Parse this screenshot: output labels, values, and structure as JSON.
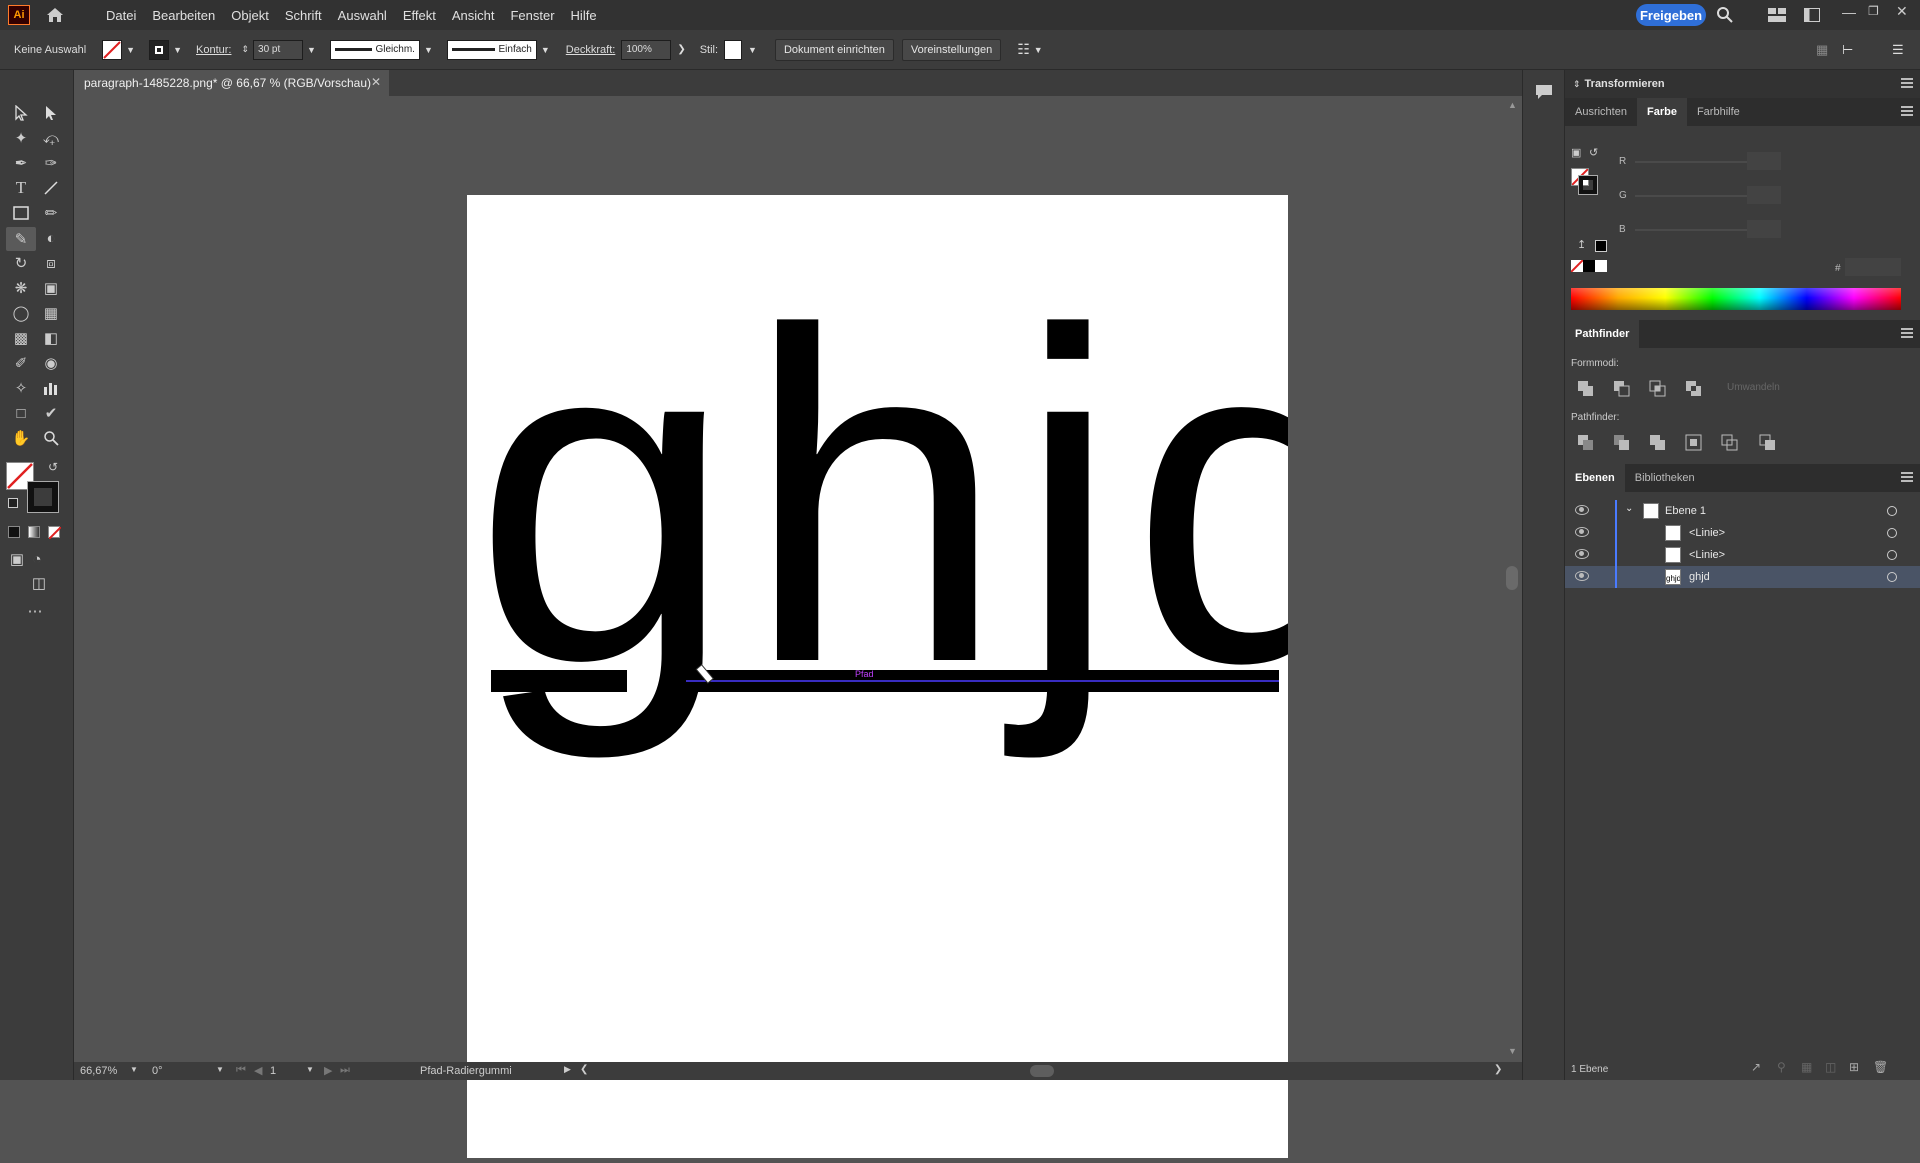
{
  "app": {
    "logo": "Ai"
  },
  "menu": [
    "Datei",
    "Bearbeiten",
    "Objekt",
    "Schrift",
    "Auswahl",
    "Effekt",
    "Ansicht",
    "Fenster",
    "Hilfe"
  ],
  "share_label": "Freigeben",
  "control": {
    "selection": "Keine Auswahl",
    "stroke_label": "Kontur:",
    "stroke_weight": "30 pt",
    "profile": "Gleichm.",
    "brush": "Einfach",
    "opacity_label": "Deckkraft:",
    "opacity": "100%",
    "style_label": "Stil:",
    "doc_setup": "Dokument einrichten",
    "prefs": "Voreinstellungen"
  },
  "document_tab": "paragraph-1485228.png* @ 66,67 % (RGB/Vorschau)",
  "canvas": {
    "text": "ghjd",
    "path_label": "Pfad"
  },
  "status": {
    "zoom": "66,67%",
    "rotation": "0°",
    "artboard": "1",
    "tool": "Pfad-Radiergummi"
  },
  "panels": {
    "transform": "Transformieren",
    "color_tabs": [
      "Ausrichten",
      "Farbe",
      "Farbhilfe"
    ],
    "channels": [
      "R",
      "G",
      "B"
    ],
    "hex_symbol": "#",
    "pathfinder_title": "Pathfinder",
    "formmodi_label": "Formmodi:",
    "expand_label": "Umwandeln",
    "pathfinder_label": "Pathfinder:",
    "layers_tabs": [
      "Ebenen",
      "Bibliotheken"
    ],
    "layers": [
      {
        "name": "Ebene 1",
        "level": 0
      },
      {
        "name": "<Linie>",
        "level": 1
      },
      {
        "name": "<Linie>",
        "level": 1
      },
      {
        "name": "ghjd",
        "level": 1,
        "selected": true
      }
    ],
    "layers_count": "1 Ebene"
  },
  "colors": {
    "accent": "#2f6fd8",
    "path_highlight": "#4a3aff",
    "layer_color": "#4a7bff",
    "selected_row": "#4a5466"
  }
}
